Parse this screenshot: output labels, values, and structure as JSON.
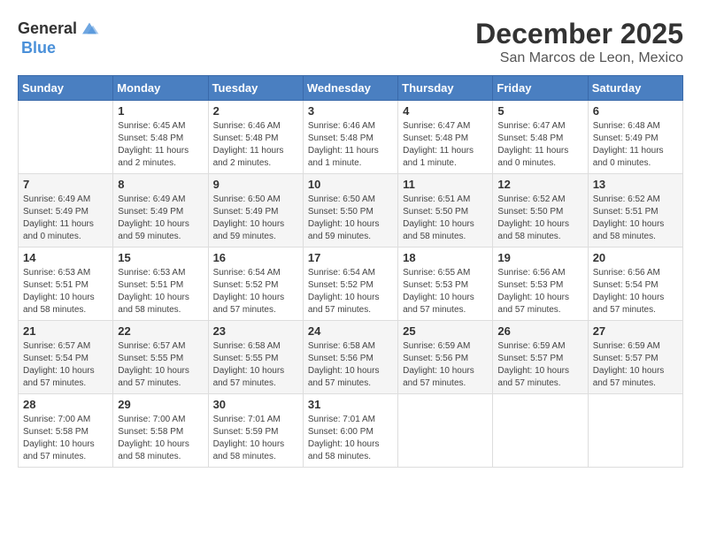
{
  "header": {
    "logo_general": "General",
    "logo_blue": "Blue",
    "month": "December 2025",
    "location": "San Marcos de Leon, Mexico"
  },
  "weekdays": [
    "Sunday",
    "Monday",
    "Tuesday",
    "Wednesday",
    "Thursday",
    "Friday",
    "Saturday"
  ],
  "weeks": [
    [
      {
        "day": "",
        "info": ""
      },
      {
        "day": "1",
        "info": "Sunrise: 6:45 AM\nSunset: 5:48 PM\nDaylight: 11 hours\nand 2 minutes."
      },
      {
        "day": "2",
        "info": "Sunrise: 6:46 AM\nSunset: 5:48 PM\nDaylight: 11 hours\nand 2 minutes."
      },
      {
        "day": "3",
        "info": "Sunrise: 6:46 AM\nSunset: 5:48 PM\nDaylight: 11 hours\nand 1 minute."
      },
      {
        "day": "4",
        "info": "Sunrise: 6:47 AM\nSunset: 5:48 PM\nDaylight: 11 hours\nand 1 minute."
      },
      {
        "day": "5",
        "info": "Sunrise: 6:47 AM\nSunset: 5:48 PM\nDaylight: 11 hours\nand 0 minutes."
      },
      {
        "day": "6",
        "info": "Sunrise: 6:48 AM\nSunset: 5:49 PM\nDaylight: 11 hours\nand 0 minutes."
      }
    ],
    [
      {
        "day": "7",
        "info": "Sunrise: 6:49 AM\nSunset: 5:49 PM\nDaylight: 11 hours\nand 0 minutes."
      },
      {
        "day": "8",
        "info": "Sunrise: 6:49 AM\nSunset: 5:49 PM\nDaylight: 10 hours\nand 59 minutes."
      },
      {
        "day": "9",
        "info": "Sunrise: 6:50 AM\nSunset: 5:49 PM\nDaylight: 10 hours\nand 59 minutes."
      },
      {
        "day": "10",
        "info": "Sunrise: 6:50 AM\nSunset: 5:50 PM\nDaylight: 10 hours\nand 59 minutes."
      },
      {
        "day": "11",
        "info": "Sunrise: 6:51 AM\nSunset: 5:50 PM\nDaylight: 10 hours\nand 58 minutes."
      },
      {
        "day": "12",
        "info": "Sunrise: 6:52 AM\nSunset: 5:50 PM\nDaylight: 10 hours\nand 58 minutes."
      },
      {
        "day": "13",
        "info": "Sunrise: 6:52 AM\nSunset: 5:51 PM\nDaylight: 10 hours\nand 58 minutes."
      }
    ],
    [
      {
        "day": "14",
        "info": "Sunrise: 6:53 AM\nSunset: 5:51 PM\nDaylight: 10 hours\nand 58 minutes."
      },
      {
        "day": "15",
        "info": "Sunrise: 6:53 AM\nSunset: 5:51 PM\nDaylight: 10 hours\nand 58 minutes."
      },
      {
        "day": "16",
        "info": "Sunrise: 6:54 AM\nSunset: 5:52 PM\nDaylight: 10 hours\nand 57 minutes."
      },
      {
        "day": "17",
        "info": "Sunrise: 6:54 AM\nSunset: 5:52 PM\nDaylight: 10 hours\nand 57 minutes."
      },
      {
        "day": "18",
        "info": "Sunrise: 6:55 AM\nSunset: 5:53 PM\nDaylight: 10 hours\nand 57 minutes."
      },
      {
        "day": "19",
        "info": "Sunrise: 6:56 AM\nSunset: 5:53 PM\nDaylight: 10 hours\nand 57 minutes."
      },
      {
        "day": "20",
        "info": "Sunrise: 6:56 AM\nSunset: 5:54 PM\nDaylight: 10 hours\nand 57 minutes."
      }
    ],
    [
      {
        "day": "21",
        "info": "Sunrise: 6:57 AM\nSunset: 5:54 PM\nDaylight: 10 hours\nand 57 minutes."
      },
      {
        "day": "22",
        "info": "Sunrise: 6:57 AM\nSunset: 5:55 PM\nDaylight: 10 hours\nand 57 minutes."
      },
      {
        "day": "23",
        "info": "Sunrise: 6:58 AM\nSunset: 5:55 PM\nDaylight: 10 hours\nand 57 minutes."
      },
      {
        "day": "24",
        "info": "Sunrise: 6:58 AM\nSunset: 5:56 PM\nDaylight: 10 hours\nand 57 minutes."
      },
      {
        "day": "25",
        "info": "Sunrise: 6:59 AM\nSunset: 5:56 PM\nDaylight: 10 hours\nand 57 minutes."
      },
      {
        "day": "26",
        "info": "Sunrise: 6:59 AM\nSunset: 5:57 PM\nDaylight: 10 hours\nand 57 minutes."
      },
      {
        "day": "27",
        "info": "Sunrise: 6:59 AM\nSunset: 5:57 PM\nDaylight: 10 hours\nand 57 minutes."
      }
    ],
    [
      {
        "day": "28",
        "info": "Sunrise: 7:00 AM\nSunset: 5:58 PM\nDaylight: 10 hours\nand 57 minutes."
      },
      {
        "day": "29",
        "info": "Sunrise: 7:00 AM\nSunset: 5:58 PM\nDaylight: 10 hours\nand 58 minutes."
      },
      {
        "day": "30",
        "info": "Sunrise: 7:01 AM\nSunset: 5:59 PM\nDaylight: 10 hours\nand 58 minutes."
      },
      {
        "day": "31",
        "info": "Sunrise: 7:01 AM\nSunset: 6:00 PM\nDaylight: 10 hours\nand 58 minutes."
      },
      {
        "day": "",
        "info": ""
      },
      {
        "day": "",
        "info": ""
      },
      {
        "day": "",
        "info": ""
      }
    ]
  ]
}
